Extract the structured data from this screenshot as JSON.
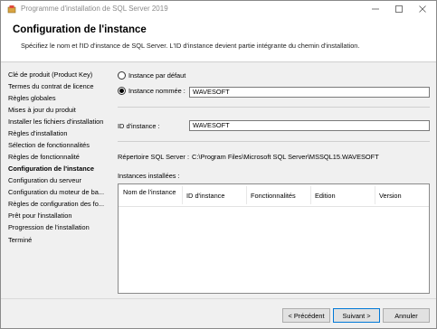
{
  "window": {
    "title": "Programme d'installation de SQL Server 2019"
  },
  "header": {
    "title": "Configuration de l'instance",
    "description": "Spécifiez le nom et l'ID d'instance de SQL Server. L'ID d'instance devient partie intégrante du chemin d'installation."
  },
  "sidebar": {
    "items": [
      {
        "label": "Clé de produit (Product Key)"
      },
      {
        "label": "Termes du contrat de licence"
      },
      {
        "label": "Règles globales"
      },
      {
        "label": "Mises à jour du produit"
      },
      {
        "label": "Installer les fichiers d'installation"
      },
      {
        "label": "Règles d'installation"
      },
      {
        "label": "Sélection de fonctionnalités"
      },
      {
        "label": "Règles de fonctionnalité"
      },
      {
        "label": "Configuration de l'instance",
        "active": true
      },
      {
        "label": "Configuration du serveur"
      },
      {
        "label": "Configuration du moteur de ba..."
      },
      {
        "label": "Règles de configuration des fo..."
      },
      {
        "label": "Prêt pour l'installation"
      },
      {
        "label": "Progression de l'installation"
      },
      {
        "label": "Terminé"
      }
    ]
  },
  "main": {
    "default_instance_label": "Instance par défaut",
    "named_instance_label": "Instance nommée :",
    "named_instance_value": "WAVESOFT",
    "selected_option": "named_instance",
    "instance_id_label": "ID d'instance :",
    "instance_id_value": "WAVESOFT",
    "sql_dir_label": "Répertoire SQL Server :",
    "sql_dir_value": "C:\\Program Files\\Microsoft SQL Server\\MSSQL15.WAVESOFT",
    "installed_instances_label": "Instances installées :",
    "table_headers": [
      "Nom de l'instance",
      "ID d'instance",
      "Fonctionnalités",
      "Edition",
      "Version"
    ]
  },
  "footer": {
    "back_label": "< Précédent",
    "next_label": "Suivant >",
    "cancel_label": "Annuler"
  },
  "icons": {
    "app": "sql-setup-icon",
    "minimize": "minimize-icon",
    "maximize": "maximize-icon",
    "close": "close-icon"
  }
}
